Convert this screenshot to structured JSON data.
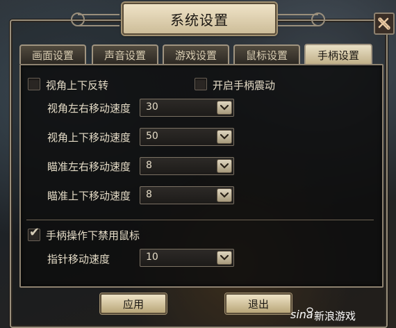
{
  "window": {
    "title": "系统设置"
  },
  "tabs": [
    {
      "label": "画面设置",
      "active": false
    },
    {
      "label": "声音设置",
      "active": false
    },
    {
      "label": "游戏设置",
      "active": false
    },
    {
      "label": "鼠标设置",
      "active": false
    },
    {
      "label": "手柄设置",
      "active": true
    }
  ],
  "controller": {
    "invert_view": {
      "label": "视角上下反转",
      "checked": false
    },
    "vibration": {
      "label": "开启手柄震动",
      "checked": false
    },
    "view_horizontal_speed": {
      "label": "视角左右移动速度",
      "value": "30"
    },
    "view_vertical_speed": {
      "label": "视角上下移动速度",
      "value": "50"
    },
    "aim_horizontal_speed": {
      "label": "瞄准左右移动速度",
      "value": "8"
    },
    "aim_vertical_speed": {
      "label": "瞄准上下移动速度",
      "value": "8"
    },
    "disable_mouse": {
      "label": "手柄操作下禁用鼠标",
      "checked": true
    },
    "pointer_speed": {
      "label": "指针移动速度",
      "value": "10"
    }
  },
  "buttons": {
    "apply": "应用",
    "exit": "退出"
  },
  "watermark": {
    "text": "新浪游戏",
    "logo": "sina"
  },
  "icons": {
    "close": "tools-close-icon",
    "dropdown": "chevron-down-icon",
    "check": "check-icon"
  },
  "colors": {
    "accent": "#cdbd99",
    "panel": "#141414",
    "text": "#e5dcc7"
  }
}
